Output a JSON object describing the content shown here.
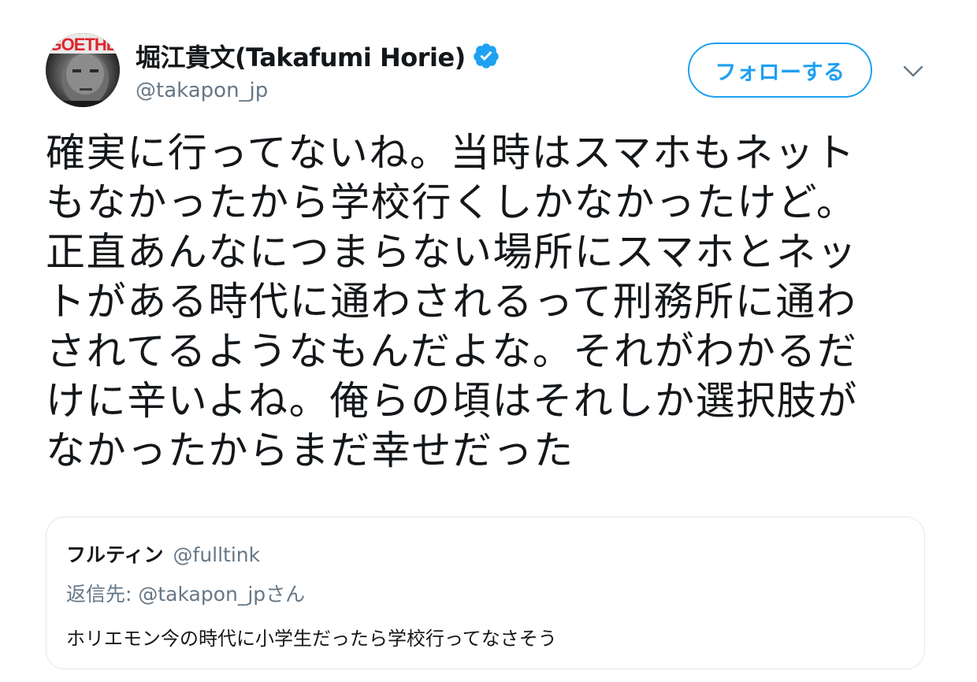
{
  "author": {
    "display_name": "堀江貴文(Takafumi Horie)",
    "handle": "@takapon_jp",
    "verified": true,
    "avatar_icon": "profile-photo-avatar",
    "avatar_banner_text": "GOETHE"
  },
  "actions": {
    "follow_label": "フォローする",
    "more_icon": "chevron-down-icon"
  },
  "tweet": {
    "text": "確実に行ってないね。当時はスマホもネット\nもなかったから学校行くしかなかったけど。\n正直あんなにつまらない場所にスマホとネッ\nトがある時代に通わされるって刑務所に通わ\nされてるようなもんだよな。それがわかるだ\nけに辛いよね。俺らの頃はそれしか選択肢が\nなかったからまだ幸せだった"
  },
  "quoted_tweet": {
    "display_name": "フルティン",
    "handle": "@fulltink",
    "reply_to": "返信先: @takapon_jpさん",
    "text": "ホリエモン今の時代に小学生だったら学校行ってなさそう"
  },
  "colors": {
    "accent": "#1da1f2",
    "secondary_text": "#657786",
    "primary_text": "#14171a",
    "border": "#e1e8ed"
  }
}
